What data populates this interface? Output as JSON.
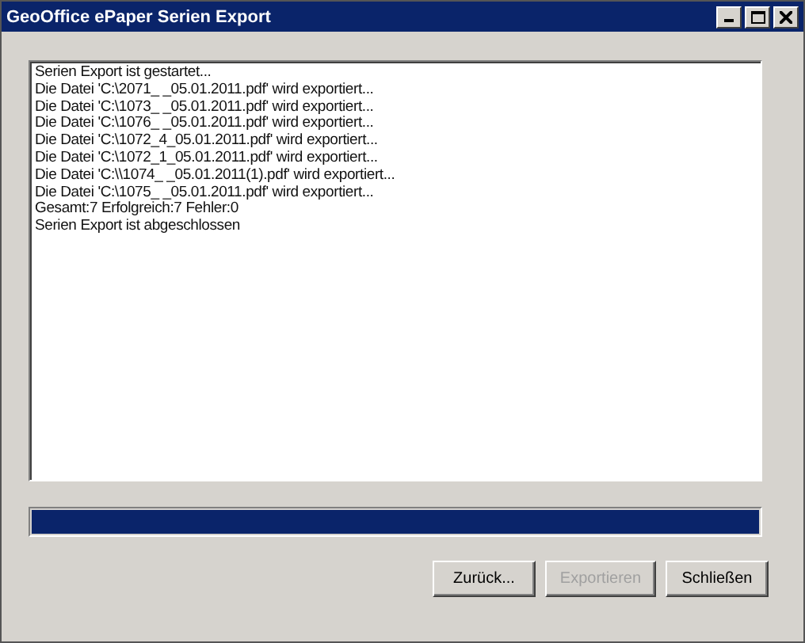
{
  "window": {
    "title": "GeoOffice ePaper Serien Export"
  },
  "log": [
    "Serien Export ist gestartet...",
    "Die Datei 'C:\\2071_ _05.01.2011.pdf' wird exportiert...",
    "Die Datei 'C:\\1073_ _05.01.2011.pdf' wird exportiert...",
    "Die Datei 'C:\\1076_ _05.01.2011.pdf' wird exportiert...",
    "Die Datei 'C:\\1072_4_05.01.2011.pdf' wird exportiert...",
    "Die Datei 'C:\\1072_1_05.01.2011.pdf' wird exportiert...",
    "Die Datei 'C:\\\\1074_ _05.01.2011(1).pdf' wird exportiert...",
    "Die Datei 'C:\\1075_ _05.01.2011.pdf' wird exportiert...",
    "Gesamt:7 Erfolgreich:7 Fehler:0",
    "Serien Export ist abgeschlossen"
  ],
  "progress": {
    "level": 1
  },
  "buttons": [
    {
      "label": "Zurück...",
      "disabled": false
    },
    {
      "label": "Exportieren",
      "disabled": true
    },
    {
      "label": "Schließen",
      "disabled": false
    }
  ]
}
